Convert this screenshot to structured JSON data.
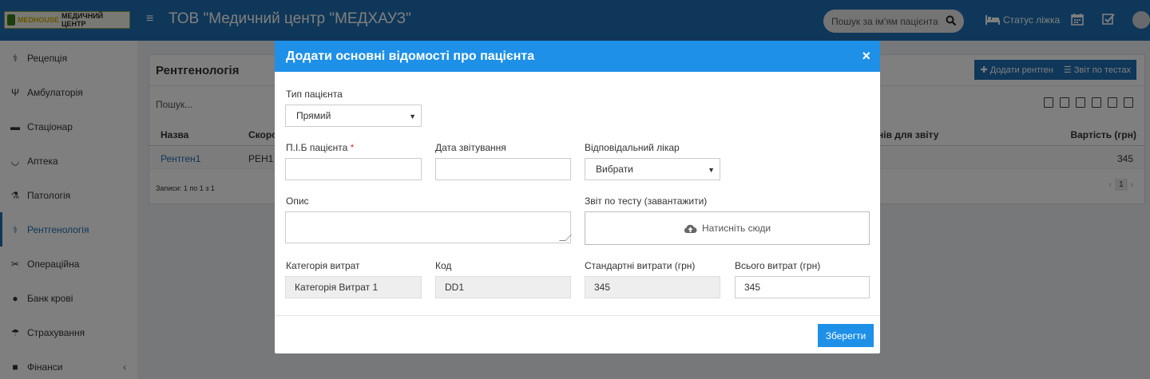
{
  "topbar": {
    "logo_brand": "MEDHOUSE",
    "logo_text": "МЕДИЧНИЙ ЦЕНТР",
    "title": "ТОВ \"Медичний центр \"МЕДХАУЗ\"",
    "search_placeholder": "Пошук за ім'ям пацієнта",
    "bed_status": "Статус ліжка",
    "icons": [
      "menu-icon",
      "search-icon",
      "bed-icon",
      "calendar-icon",
      "checkbox-icon",
      "user-avatar-icon"
    ]
  },
  "sidebar": {
    "items": [
      {
        "label": "Рецепція",
        "icon": "reception-icon"
      },
      {
        "label": "Амбулаторія",
        "icon": "stethoscope-icon"
      },
      {
        "label": "Стаціонар",
        "icon": "bed-icon"
      },
      {
        "label": "Аптека",
        "icon": "mortar-icon"
      },
      {
        "label": "Патологія",
        "icon": "flask-icon"
      },
      {
        "label": "Рентгенологія",
        "icon": "xray-icon",
        "active": true
      },
      {
        "label": "Операційна",
        "icon": "scissors-icon"
      },
      {
        "label": "Банк крові",
        "icon": "drop-icon"
      },
      {
        "label": "Страхування",
        "icon": "umbrella-icon"
      },
      {
        "label": "Фінанси",
        "icon": "finance-icon"
      }
    ]
  },
  "page": {
    "title": "Рентгенологія",
    "add_button": "Додати рентген",
    "report_button": "Звіт по тестах",
    "search_placeholder": "Пошук...",
    "columns": {
      "name": "Назва",
      "short": "Скороч",
      "days": "нів для звіту",
      "cost": "Вартість (грн)"
    },
    "row": {
      "name": "Рентген1",
      "short": "РЕН1",
      "cost": "345"
    },
    "records": "Записи: 1 по 1 з 1",
    "page_number": "1"
  },
  "modal": {
    "title": "Додати основні відомості про пацієнта",
    "close": "×",
    "patient_type_label": "Тип пацієнта",
    "patient_type_value": "Прямий",
    "name_label": "П.І.Б пацієнта",
    "required_mark": "*",
    "name_value": "",
    "report_date_label": "Дата звітування",
    "report_date_value": "",
    "doctor_label": "Відповідальний лікар",
    "doctor_value": "Вибрати",
    "description_label": "Опис",
    "description_value": "",
    "test_report_label": "Звіт по тесту (завантажити)",
    "upload_text": "Натисніть сюди",
    "cost_category_label": "Категорія витрат",
    "cost_category_value": "Категорія Витрат 1",
    "code_label": "Код",
    "code_value": "DD1",
    "standard_cost_label": "Стандартні витрати (грн)",
    "standard_cost_value": "345",
    "total_cost_label": "Всього витрат (грн)",
    "total_cost_value": "345",
    "save_button": "Зберегти"
  },
  "colors": {
    "topbar": "#1f6fb2",
    "modal_header": "#1e90e8",
    "accent": "#1e90e8"
  }
}
